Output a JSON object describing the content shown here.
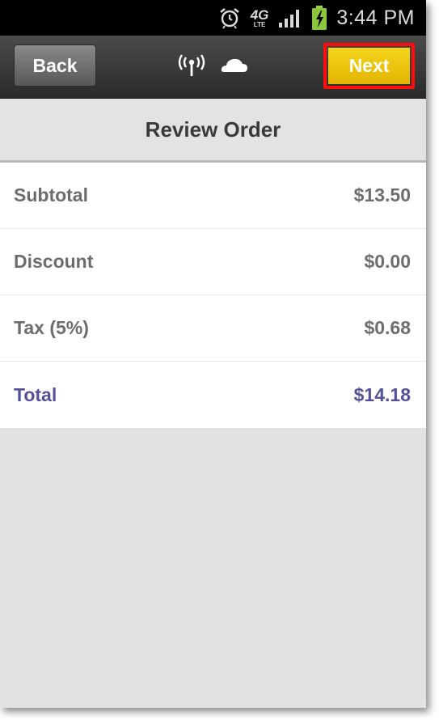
{
  "status_bar": {
    "time": "3:44 PM",
    "network_label": "4G",
    "network_sub_label": "LTE",
    "icons": [
      "alarm-clock-icon",
      "4g-lte-icon",
      "signal-strength-icon",
      "battery-charging-icon"
    ]
  },
  "action_bar": {
    "back_label": "Back",
    "next_label": "Next",
    "icons": [
      "wireless-broadcast-icon",
      "cloud-icon"
    ],
    "colors": {
      "next_button": "#e9c000",
      "highlight_outline": "#ff0d0d",
      "back_button": "#6f6f6f"
    }
  },
  "page": {
    "title": "Review Order"
  },
  "order_summary": [
    {
      "label": "Subtotal",
      "amount": "$13.50"
    },
    {
      "label": "Discount",
      "amount": "$0.00"
    },
    {
      "label": "Tax (5%)",
      "amount": "$0.68"
    },
    {
      "label": "Total",
      "amount": "$14.18",
      "emphasis": true
    }
  ],
  "colors": {
    "total_text": "#55509a",
    "row_text": "#6d6d6d",
    "background": "#e2e2e2"
  }
}
